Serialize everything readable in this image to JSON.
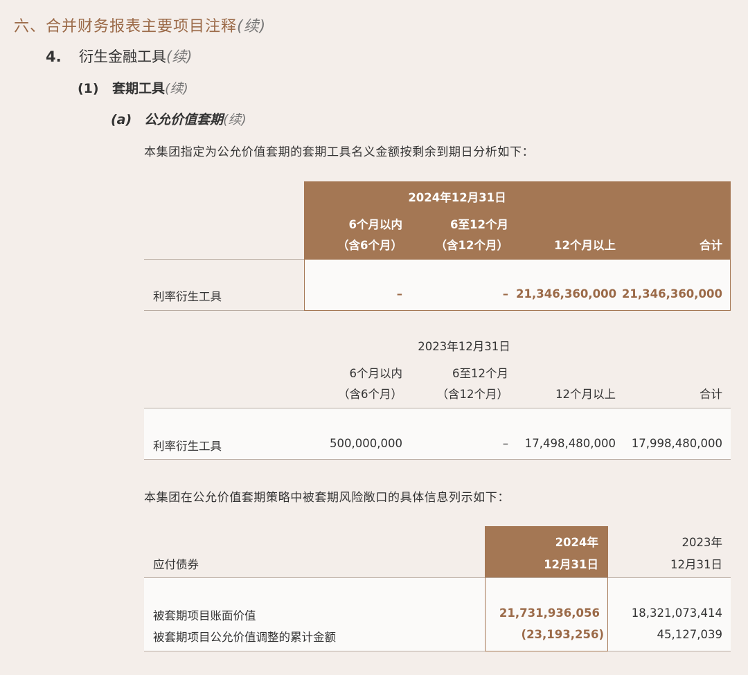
{
  "heading1": {
    "text": "六、合并财务报表主要项目注释",
    "cont": "(续)"
  },
  "heading2": {
    "num": "4.",
    "text": "衍生金融工具",
    "cont": "(续)"
  },
  "heading3": {
    "num": "(1)",
    "text": "套期工具",
    "cont": "(续)"
  },
  "heading4": {
    "num": "(a)",
    "text": "公允价值套期",
    "cont": "(续)"
  },
  "intro1": "本集团指定为公允价值套期的套期工具名义金额按剩余到期日分析如下：",
  "table2024": {
    "date": "2024年12月31日",
    "col1_line1": "6个月以内",
    "col1_line2": "（含6个月）",
    "col2_line1": "6至12个月",
    "col2_line2": "（含12个月）",
    "col3": "12个月以上",
    "col4": "合计",
    "row_label": "利率衍生工具",
    "values": [
      "–",
      "–",
      "21,346,360,000",
      "21,346,360,000"
    ]
  },
  "table2023": {
    "date": "2023年12月31日",
    "col1_line1": "6个月以内",
    "col1_line2": "（含6个月）",
    "col2_line1": "6至12个月",
    "col2_line2": "（含12个月）",
    "col3": "12个月以上",
    "col4": "合计",
    "row_label": "利率衍生工具",
    "values": [
      "500,000,000",
      "–",
      "17,498,480,000",
      "17,998,480,000"
    ]
  },
  "intro2": "本集团在公允价值套期策略中被套期风险敞口的具体信息列示如下：",
  "table3": {
    "label": "应付债券",
    "col2024_line1": "2024年",
    "col2024_line2": "12月31日",
    "col2023_line1": "2023年",
    "col2023_line2": "12月31日",
    "rows": [
      {
        "label": "被套期项目账面价值",
        "v2024": "21,731,936,056",
        "v2023": "18,321,073,414"
      },
      {
        "label": "被套期项目公允价值调整的累计金额",
        "v2024": "(23,193,256)",
        "v2023": "45,127,039"
      }
    ]
  }
}
